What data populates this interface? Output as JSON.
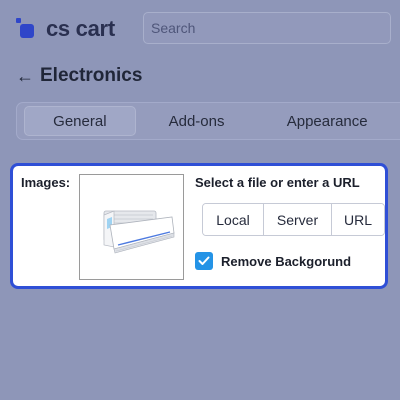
{
  "header": {
    "logo_text": "cs cart",
    "search_placeholder": "Search"
  },
  "page": {
    "title": "Electronics"
  },
  "tabs": [
    {
      "label": "General",
      "active": true
    },
    {
      "label": "Add-ons",
      "active": false
    },
    {
      "label": "Appearance",
      "active": false
    }
  ],
  "images_panel": {
    "label": "Images:",
    "select_label": "Select a file or enter a URL",
    "sources": [
      "Local",
      "Server",
      "URL"
    ],
    "remove_background": {
      "label": "Remove Backgorund",
      "checked": true
    },
    "thumbnail": "air-conditioner-image"
  },
  "colors": {
    "accent": "#2f4fd6",
    "checkbox": "#2493e6",
    "brand": "#2f46c9",
    "overlay": "#8e96b8"
  }
}
